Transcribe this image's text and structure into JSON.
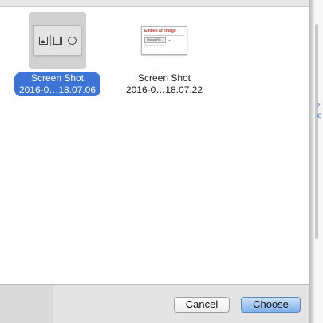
{
  "file_browser": {
    "items": [
      {
        "name_line1": "Screen Shot",
        "name_line2": "2016-0…18.07.06",
        "selected": true,
        "thumbnail": {
          "icons": [
            "image-icon",
            "film-icon",
            "smiley-icon"
          ]
        }
      },
      {
        "name_line1": "Screen Shot",
        "name_line2": "2016-0…18.07.22",
        "selected": false,
        "thumbnail": {
          "title": "Embed an Image",
          "button": "Upload File…",
          "dot": "●",
          "note": "Selected: 1 files"
        }
      }
    ]
  },
  "footer": {
    "cancel_label": "Cancel",
    "choose_label": "Choose"
  },
  "backdrop": {
    "glyphs": [
      "›",
      "e"
    ]
  },
  "colors": {
    "selection": "#3d75d6",
    "default_button_top": "#cfe2fb",
    "default_button_bottom": "#7eb2ee",
    "thumb_title": "#b43b2a"
  }
}
